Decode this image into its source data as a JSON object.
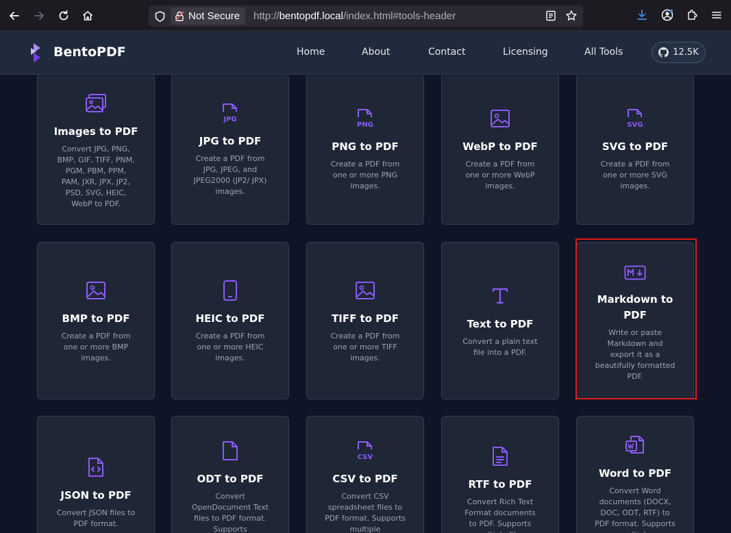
{
  "browser": {
    "not_secure": "Not Secure",
    "url_scheme": "http://",
    "url_host": "bentopdf.local",
    "url_path": "/index.html#tools-header"
  },
  "header": {
    "brand": "BentoPDF",
    "nav": [
      "Home",
      "About",
      "Contact",
      "Licensing",
      "All Tools"
    ],
    "github_stars": "12.5K"
  },
  "tools": [
    {
      "title": "Images to PDF",
      "desc": "Convert JPG, PNG, BMP, GIF, TIFF, PNM, PGM, PBM, PPM, PAM, JXR, JPX, JP2, PSD, SVG, HEIC, WebP to PDF.",
      "icon": "images-icon"
    },
    {
      "title": "JPG to PDF",
      "desc": "Create a PDF from JPG, JPEG, and JPEG2000 (JP2/ JPX) images.",
      "icon": "jpg-file-icon",
      "badge": "JPG"
    },
    {
      "title": "PNG to PDF",
      "desc": "Create a PDF from one or more PNG images.",
      "icon": "png-file-icon",
      "badge": "PNG"
    },
    {
      "title": "WebP to PDF",
      "desc": "Create a PDF from one or more WebP images.",
      "icon": "image-icon"
    },
    {
      "title": "SVG to PDF",
      "desc": "Create a PDF from one or more SVG images.",
      "icon": "svg-file-icon",
      "badge": "SVG"
    },
    {
      "title": "BMP to PDF",
      "desc": "Create a PDF from one or more BMP images.",
      "icon": "image-icon"
    },
    {
      "title": "HEIC to PDF",
      "desc": "Create a PDF from one or more HEIC images.",
      "icon": "smartphone-icon"
    },
    {
      "title": "TIFF to PDF",
      "desc": "Create a PDF from one or more TIFF images.",
      "icon": "image-icon"
    },
    {
      "title": "Text to PDF",
      "desc": "Convert a plain text file into a PDF.",
      "icon": "type-icon"
    },
    {
      "title": "Markdown to PDF",
      "desc": "Write or paste Markdown and export it as a beautifully formatted PDF.",
      "icon": "markdown-icon"
    },
    {
      "title": "JSON to PDF",
      "desc": "Convert JSON files to PDF format.",
      "icon": "code-file-icon"
    },
    {
      "title": "ODT to PDF",
      "desc": "Convert OpenDocument Text files to PDF format. Supports",
      "icon": "file-icon"
    },
    {
      "title": "CSV to PDF",
      "desc": "Convert CSV spreadsheet files to PDF format. Supports multiple",
      "icon": "csv-file-icon",
      "badge": "CSV"
    },
    {
      "title": "RTF to PDF",
      "desc": "Convert Rich Text Format documents to PDF. Supports multiple files",
      "icon": "text-file-icon"
    },
    {
      "title": "Word to PDF",
      "desc": "Convert Word documents (DOCX, DOC, ODT, RTF) to PDF format. Supports multiple",
      "icon": "word-file-icon"
    }
  ],
  "colors": {
    "accent": "#8b5cf6",
    "highlight": "#e11d1d"
  }
}
